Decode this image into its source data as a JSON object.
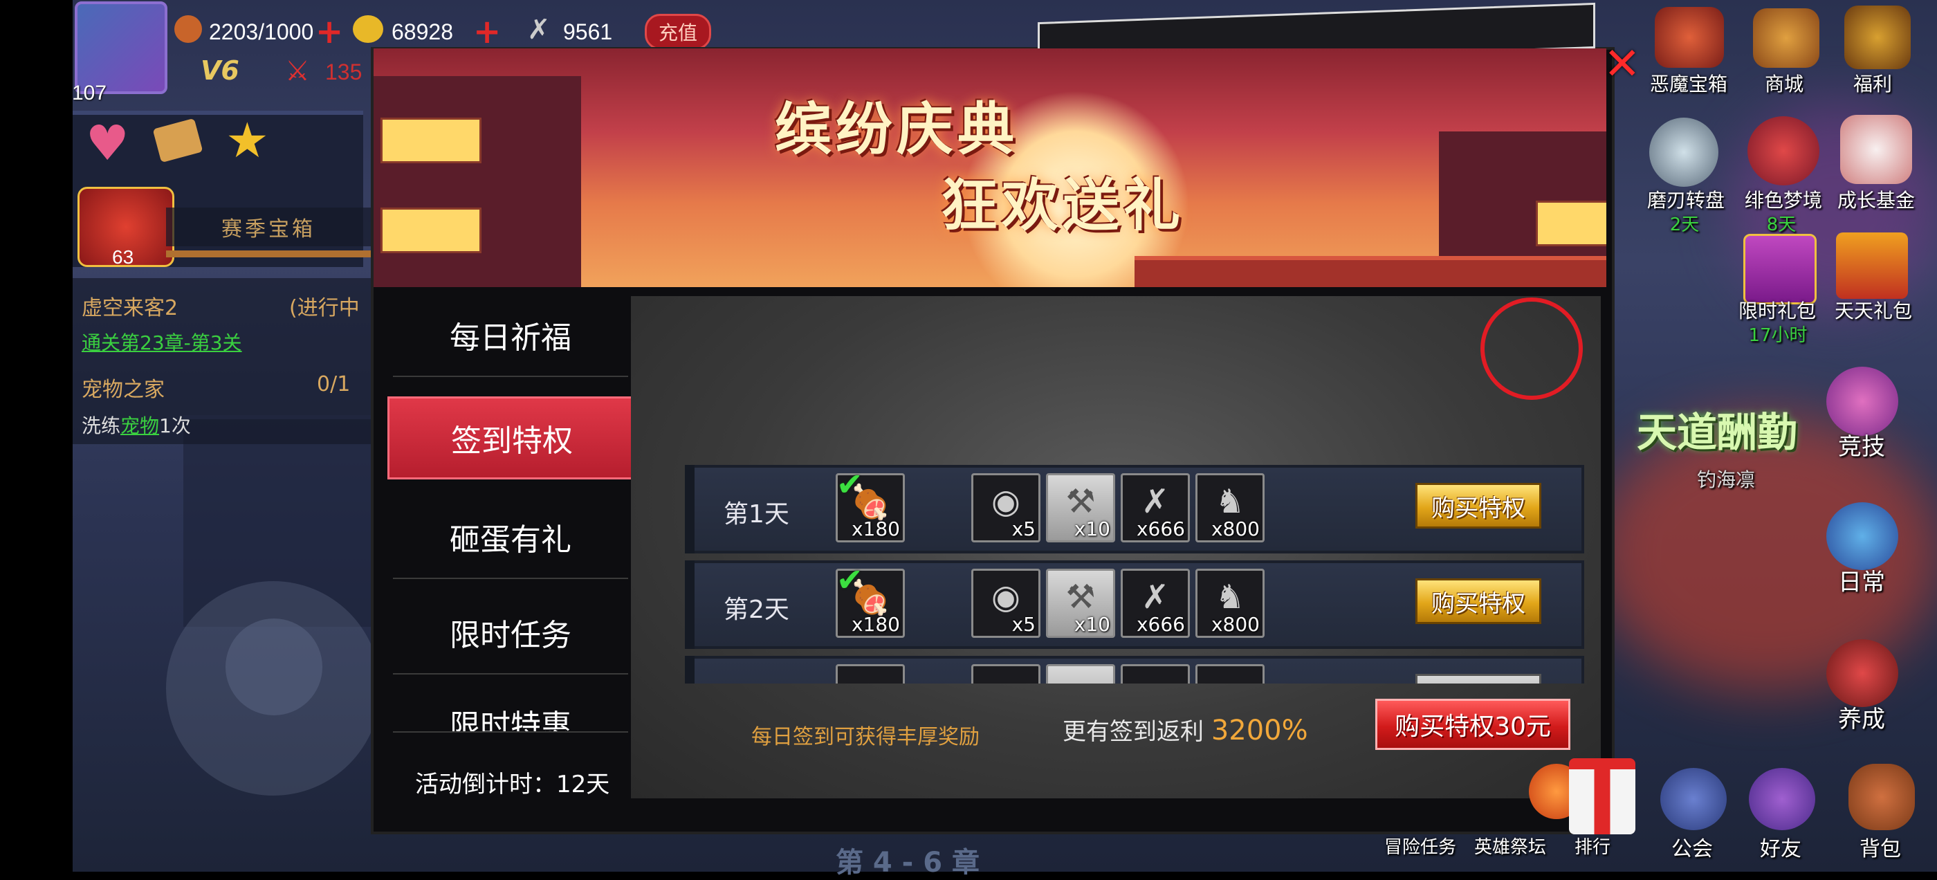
{
  "hud": {
    "level": "107",
    "vip": "V6",
    "power_partial": "135",
    "stamina": "2203/1000",
    "gold": "68928",
    "gems": "9561",
    "recharge_label": "充值",
    "season_chest_label": "赛季宝箱",
    "season_chest_count": "63"
  },
  "quests": [
    {
      "title": "虚空来客2",
      "status": "(进行中",
      "detail": "通关第23章-第3关"
    },
    {
      "title": "宠物之家",
      "status": "0/1",
      "detail_prefix": "洗练",
      "detail_link": "宠物",
      "detail_suffix": "1次"
    }
  ],
  "right_menu": {
    "top": [
      "恶魔宝箱",
      "商城",
      "福利"
    ],
    "mid": [
      {
        "label": "磨刃转盘",
        "sub": "2天"
      },
      {
        "label": "绯色梦境",
        "sub": "8天"
      },
      {
        "label": "成长基金",
        "sub": ""
      }
    ],
    "mid2": [
      {
        "label": "限时礼包",
        "sub": "17小时"
      },
      {
        "label": "天天礼包",
        "sub": ""
      }
    ],
    "banner_text": "天道酬勤",
    "banner_sub": "钓海凛",
    "side": [
      "竞技",
      "日常",
      "养成"
    ],
    "bottom": [
      "冒险任务",
      "英雄祭坛",
      "排行",
      "公会",
      "好友",
      "背包"
    ]
  },
  "chapter": "第 4 - 6 章",
  "modal": {
    "banner_line1": "缤纷庆典",
    "banner_line2": "狂欢送礼",
    "menu": [
      "每日祈福",
      "签到特权",
      "砸蛋有礼",
      "限时任务",
      "限时特惠"
    ],
    "active_index": 1,
    "countdown_label": "活动倒计时：",
    "countdown_value": "12天",
    "rows": [
      {
        "day": "第1天",
        "checked": true,
        "items": [
          {
            "icon": "meat-icon",
            "count": "x180"
          },
          {
            "icon": "coin-icon",
            "count": "x5"
          },
          {
            "icon": "hammer-icon",
            "count": "x10"
          },
          {
            "icon": "bone-icon",
            "count": "x666"
          },
          {
            "icon": "drumstick-icon",
            "count": "x800"
          }
        ],
        "button": "购买特权"
      },
      {
        "day": "第2天",
        "checked": true,
        "items": [
          {
            "icon": "meat-icon",
            "count": "x180"
          },
          {
            "icon": "coin-icon",
            "count": "x5"
          },
          {
            "icon": "hammer-icon",
            "count": "x10"
          },
          {
            "icon": "bone-icon",
            "count": "x666"
          },
          {
            "icon": "drumstick-icon",
            "count": "x800"
          }
        ],
        "button": "购买特权"
      }
    ],
    "footer_note": "每日签到可获得丰厚奖励",
    "footer_return_label": "更有签到返利",
    "footer_return_pct": "3200%",
    "buy_button": "购买特权30元"
  },
  "colors": {
    "accent_red": "#d21b1b",
    "gold_button": "#e2a619",
    "menu_active": "#c42636"
  }
}
